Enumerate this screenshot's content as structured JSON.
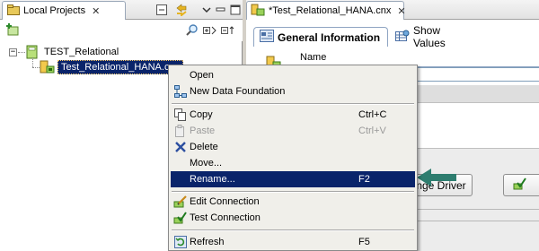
{
  "left_view": {
    "tab_label": "Local Projects",
    "tree": {
      "project_label": "TEST_Relational",
      "connection_label": "Test_Relational_HANA.cnx",
      "expander_symbol": "−"
    }
  },
  "editor": {
    "tab_label": "*Test_Relational_HANA.cnx",
    "subtabs": [
      "General Information",
      "Show Values"
    ],
    "name_label": "Name",
    "change_driver_label": "Change Driver"
  },
  "context_menu": {
    "items": [
      {
        "label": "Open",
        "shortcut": "",
        "icon": "none",
        "enabled": true
      },
      {
        "label": "New Data Foundation",
        "shortcut": "",
        "icon": "data-foundation-icon",
        "enabled": true
      },
      {
        "label": "Copy",
        "shortcut": "Ctrl+C",
        "icon": "copy-icon",
        "enabled": true
      },
      {
        "label": "Paste",
        "shortcut": "Ctrl+V",
        "icon": "paste-icon",
        "enabled": false
      },
      {
        "label": "Delete",
        "shortcut": "",
        "icon": "delete-icon",
        "enabled": true
      },
      {
        "label": "Move...",
        "shortcut": "",
        "icon": "none",
        "enabled": true
      },
      {
        "label": "Rename...",
        "shortcut": "F2",
        "icon": "none",
        "enabled": true,
        "selected": true
      },
      {
        "label": "Edit Connection",
        "shortcut": "",
        "icon": "edit-connection-icon",
        "enabled": true
      },
      {
        "label": "Test Connection",
        "shortcut": "",
        "icon": "test-connection-icon",
        "enabled": true
      },
      {
        "label": "Refresh",
        "shortcut": "F5",
        "icon": "refresh-icon",
        "enabled": true
      }
    ]
  },
  "colors": {
    "selection": "#0a246a",
    "menu_bg": "#f0efea",
    "arrow": "#2e7d6f"
  }
}
